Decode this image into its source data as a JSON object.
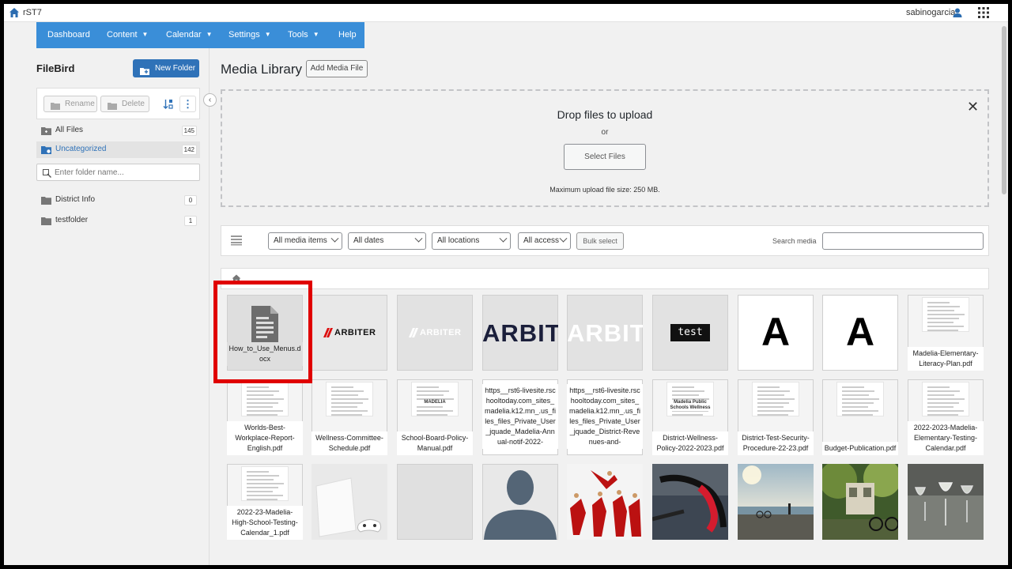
{
  "topbar": {
    "site_name": "rST7",
    "username": "sabinogarcia"
  },
  "nav": {
    "items": [
      {
        "label": "Dashboard",
        "dropdown": false
      },
      {
        "label": "Content",
        "dropdown": true
      },
      {
        "label": "Calendar",
        "dropdown": true
      },
      {
        "label": "Settings",
        "dropdown": true
      },
      {
        "label": "Tools",
        "dropdown": true
      },
      {
        "label": "Help",
        "dropdown": false
      }
    ]
  },
  "sidebar": {
    "title": "FileBird",
    "new_folder_label": "New Folder",
    "rename_label": "Rename",
    "delete_label": "Delete",
    "search_placeholder": "Enter folder name...",
    "all_files": {
      "label": "All Files",
      "count": "145"
    },
    "uncategorized": {
      "label": "Uncategorized",
      "count": "142"
    },
    "folders": [
      {
        "label": "District Info",
        "count": "0"
      },
      {
        "label": "testfolder",
        "count": "1"
      }
    ]
  },
  "main": {
    "title": "Media Library",
    "add_media_label": "Add Media File",
    "dropzone": {
      "title": "Drop files to upload",
      "or": "or",
      "select_label": "Select Files",
      "max_size": "Maximum upload file size: 250 MB."
    },
    "filters": {
      "media_type": "All media items",
      "dates": "All dates",
      "locations": "All locations",
      "access": "All access",
      "bulk_select": "Bulk select",
      "search_label": "Search media"
    }
  },
  "tiles": [
    {
      "kind": "doc",
      "name": "How_to_Use_Menus.docx"
    },
    {
      "kind": "logo-red",
      "text": "ARBITER"
    },
    {
      "kind": "logo-white",
      "text": "ARBITER"
    },
    {
      "kind": "big-dark",
      "text": "ARBIT"
    },
    {
      "kind": "big-white",
      "text": "ARBIT"
    },
    {
      "kind": "test",
      "text": "test"
    },
    {
      "kind": "letter",
      "text": "A"
    },
    {
      "kind": "letter",
      "text": "A"
    },
    {
      "kind": "pdf",
      "name": "Madelia-Elementary-Literacy-Plan.pdf"
    },
    {
      "kind": "pdf",
      "name": "Worlds-Best-Workplace-Report-English.pdf"
    },
    {
      "kind": "pdf",
      "name": "Wellness-Committee-Schedule.pdf"
    },
    {
      "kind": "pdf",
      "name": "School-Board-Policy-Manual.pdf",
      "preview_text": "MADELIA"
    },
    {
      "kind": "text",
      "name": "https__rst6-livesite.rschooltoday.com_sites_madelia.k12.mn_.us_files_files_Private_User_jquade_Madelia-Annual-notif-2022-"
    },
    {
      "kind": "text",
      "name": "https__rst6-livesite.rschooltoday.com_sites_madelia.k12.mn_.us_files_files_Private_User_jquade_District-Revenues-and-"
    },
    {
      "kind": "pdf",
      "name": "District-Wellness-Policy-2022-2023.pdf",
      "preview_text": "Madelia Public Schools Wellness"
    },
    {
      "kind": "pdf",
      "name": "District-Test-Security-Procedure-22-23.pdf"
    },
    {
      "kind": "pdf",
      "name": "Budget-Publication.pdf"
    },
    {
      "kind": "pdf",
      "name": "2022-2023-Madelia-Elementary-Testing-Calendar.pdf"
    },
    {
      "kind": "pdf",
      "name": "2022-23-Madelia-High-School-Testing-Calendar_1.pdf"
    },
    {
      "kind": "photo-console"
    },
    {
      "kind": "blank"
    },
    {
      "kind": "photo-avatar"
    },
    {
      "kind": "photo-cheer"
    },
    {
      "kind": "photo-bike"
    },
    {
      "kind": "photo-lake"
    },
    {
      "kind": "photo-park"
    },
    {
      "kind": "photo-glasses"
    }
  ],
  "colors": {
    "accent": "#3a8ed8",
    "button": "#2f72b8",
    "highlight": "#e00000"
  }
}
